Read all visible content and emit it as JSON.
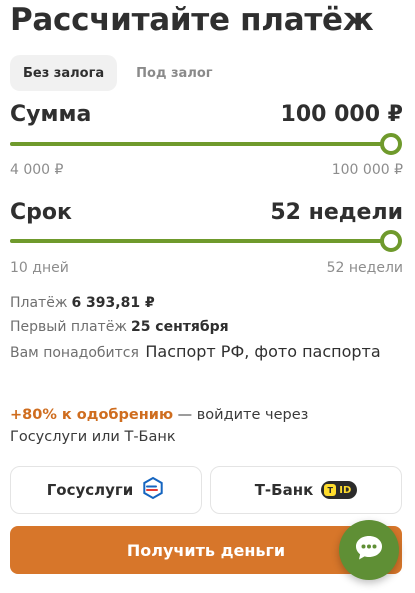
{
  "title": "Рассчитайте платёж",
  "tabs": [
    {
      "label": "Без залога",
      "active": true
    },
    {
      "label": "Под залог",
      "active": false
    }
  ],
  "amount": {
    "label": "Сумма",
    "value": "100 000 ₽",
    "min_label": "4 000 ₽",
    "max_label": "100 000 ₽",
    "fraction": 1.0
  },
  "term": {
    "label": "Срок",
    "value": "52 недели",
    "min_label": "10 дней",
    "max_label": "52 недели",
    "fraction": 1.0
  },
  "summary": {
    "payment_label": "Платёж",
    "payment_value": "6 393,81 ₽",
    "first_payment_label": "Первый платёж",
    "first_payment_value": "25 сентября",
    "docs_label": "Вам понадобится",
    "docs_value": "Паспорт РФ, фото паспорта"
  },
  "promo": {
    "accent": "+80% к одобрению",
    "rest": " — войдите через Госуслуги или Т-Банк"
  },
  "auth": {
    "gosuslugi_label": "Госуслуги",
    "tbank_label": "Т-Банк",
    "tbank_badge": "ID"
  },
  "cta_label": "Получить деньги",
  "colors": {
    "slider_green": "#6f9a2c",
    "cta_orange": "#d7762a",
    "accent_orange": "#cf6d1f",
    "chat_green": "#5f8f35"
  },
  "icons": {
    "gosuslugi": "gosuslugi-logo-icon",
    "tbank": "tbank-id-icon",
    "chat": "chat-bubble-icon"
  }
}
